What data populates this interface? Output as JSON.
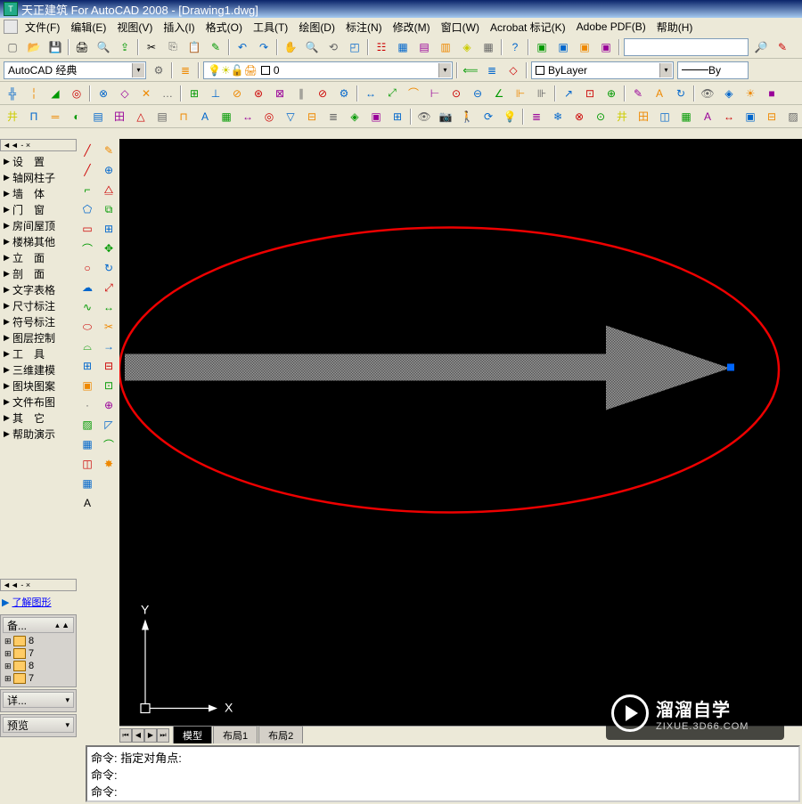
{
  "title": "天正建筑 For AutoCAD 2008 - [Drawing1.dwg]",
  "menus": [
    "文件(F)",
    "编辑(E)",
    "视图(V)",
    "插入(I)",
    "格式(O)",
    "工具(T)",
    "绘图(D)",
    "标注(N)",
    "修改(M)",
    "窗口(W)",
    "Acrobat 标记(K)",
    "Adobe PDF(B)",
    "帮助(H)"
  ],
  "workspace": {
    "label": "AutoCAD 经典"
  },
  "layer": {
    "value": "0"
  },
  "bylayer": {
    "value": "ByLayer"
  },
  "linetype": {
    "value": "By"
  },
  "sidebar_items": [
    "设　置",
    "轴网柱子",
    "墙　体",
    "门　窗",
    "房间屋顶",
    "楼梯其他",
    "立　面",
    "剖　面",
    "文字表格",
    "尺寸标注",
    "符号标注",
    "图层控制",
    "工　具",
    "三维建模",
    "图块图案",
    "文件布图",
    "其　它",
    "帮助演示"
  ],
  "link": {
    "label": "了解图形"
  },
  "panel1": {
    "title": "备...",
    "items": [
      "8",
      "7",
      "8",
      "7"
    ]
  },
  "panel2": {
    "title": "详..."
  },
  "panel3": {
    "title": "预览"
  },
  "tabs": {
    "model": "模型",
    "layout1": "布局1",
    "layout2": "布局2"
  },
  "ucs": {
    "x": "X",
    "y": "Y"
  },
  "cmd": {
    "l1": "命令: 指定对角点:",
    "l2": "命令:",
    "l3": "命令:"
  },
  "watermark": {
    "big": "溜溜自学",
    "small": "ZIXUE.3D66.COM"
  }
}
